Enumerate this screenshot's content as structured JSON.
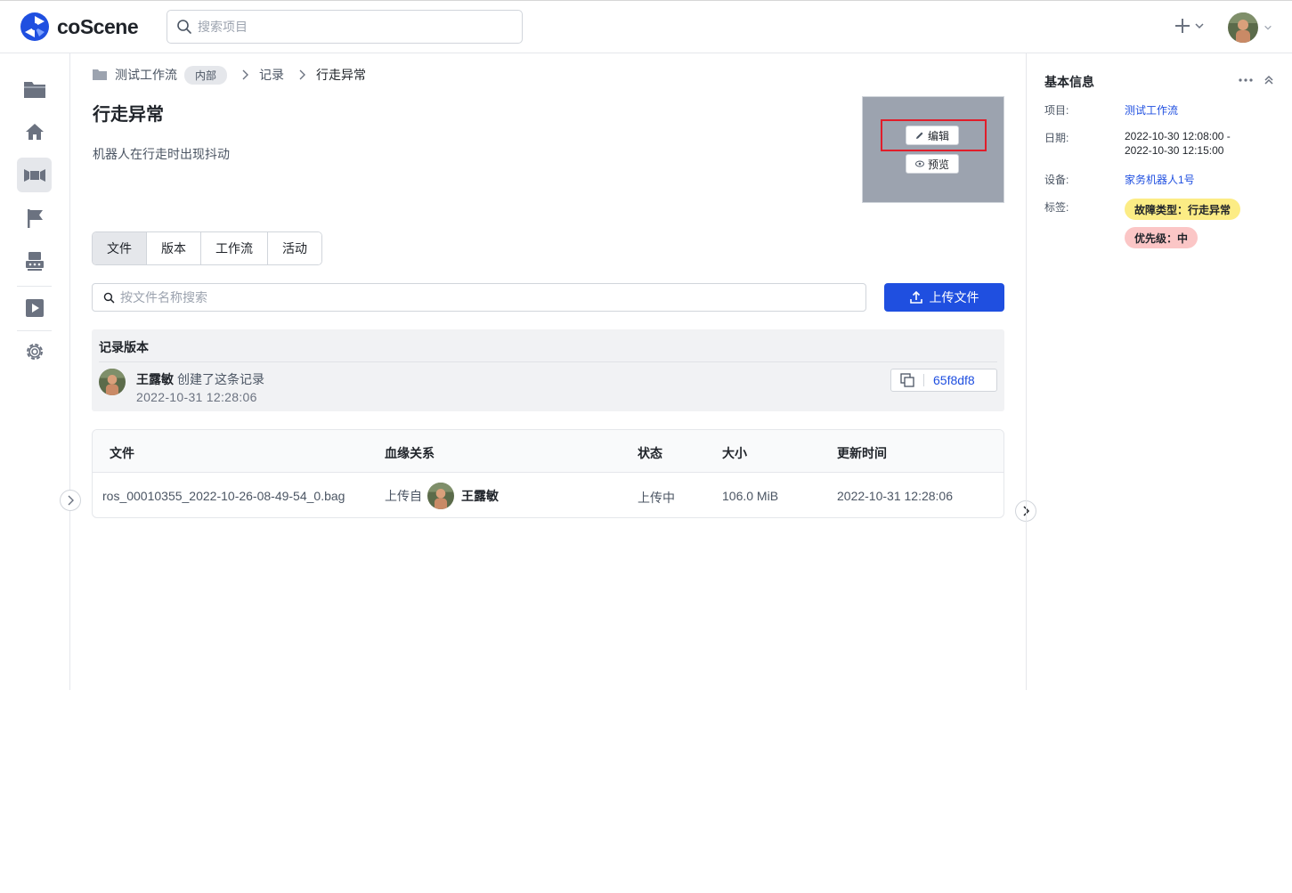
{
  "app": {
    "logo_text": "coScene"
  },
  "header": {
    "search_placeholder": "搜索项目"
  },
  "breadcrumb": {
    "project": "测试工作流",
    "visibility": "内部",
    "section": "记录",
    "current": "行走异常"
  },
  "record": {
    "title": "行走异常",
    "description": "机器人在行走时出现抖动"
  },
  "thumbnail": {
    "edit_label": "编辑",
    "preview_label": "预览"
  },
  "tabs": [
    {
      "label": "文件"
    },
    {
      "label": "版本"
    },
    {
      "label": "工作流"
    },
    {
      "label": "活动"
    }
  ],
  "files": {
    "search_placeholder": "按文件名称搜索",
    "upload_label": "上传文件"
  },
  "version": {
    "title": "记录版本",
    "user": "王露敏",
    "action": "创建了这条记录",
    "time": "2022-10-31 12:28:06",
    "commit": "65f8df8"
  },
  "table": {
    "headers": [
      "文件",
      "血缘关系",
      "状态",
      "大小",
      "更新时间"
    ],
    "rows": [
      {
        "file": "ros_00010355_2022-10-26-08-49-54_0.bag",
        "lineage_prefix": "上传自",
        "lineage_user": "王露敏",
        "status": "上传中",
        "size": "106.0 MiB",
        "updated": "2022-10-31 12:28:06"
      }
    ]
  },
  "info_panel": {
    "title": "基本信息",
    "project_label": "项目:",
    "project_value": "测试工作流",
    "date_label": "日期:",
    "date_start": "2022-10-30 12:08:00 -",
    "date_end": "2022-10-30 12:15:00",
    "device_label": "设备:",
    "device_value": "家务机器人1号",
    "tags_label": "标签:",
    "tags": [
      {
        "text": "故障类型：行走异常",
        "color": "#fcec85"
      },
      {
        "text": "优先级：中",
        "color": "#fbc6c6"
      }
    ]
  },
  "colors": {
    "primary": "#1f4fe0",
    "highlight": "#e11d2a"
  },
  "icons": {
    "sidebar": [
      "folder-icon",
      "home-icon",
      "records-icon",
      "flag-icon",
      "device-icon",
      "play-icon",
      "settings-icon"
    ]
  }
}
